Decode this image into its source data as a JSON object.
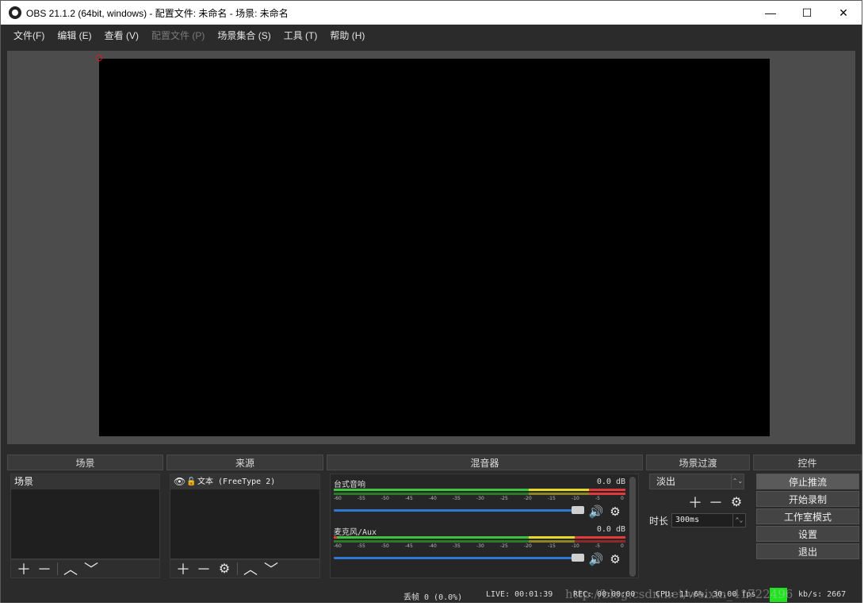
{
  "window": {
    "title": "OBS 21.1.2 (64bit, windows) - 配置文件: 未命名 - 场景: 未命名",
    "minimize": "—",
    "maximize": "☐",
    "close": "✕"
  },
  "menu": [
    {
      "label": "文件(F)",
      "enabled": true
    },
    {
      "label": "编辑 (E)",
      "enabled": true
    },
    {
      "label": "查看 (V)",
      "enabled": true
    },
    {
      "label": "配置文件 (P)",
      "enabled": false
    },
    {
      "label": "场景集合 (S)",
      "enabled": true
    },
    {
      "label": "工具 (T)",
      "enabled": true
    },
    {
      "label": "帮助 (H)",
      "enabled": true
    }
  ],
  "docks": {
    "scenes": {
      "title": "场景",
      "items": [
        "场景"
      ]
    },
    "sources": {
      "title": "来源",
      "items": [
        "文本 (FreeType 2)"
      ]
    },
    "mixer": {
      "title": "混音器",
      "channels": [
        {
          "name": "台式音响",
          "db": "0.0 dB",
          "volume": 0.92
        },
        {
          "name": "麦克风/Aux",
          "db": "0.0 dB",
          "volume": 0.92
        }
      ],
      "ticks": [
        "-60",
        "-55",
        "-50",
        "-45",
        "-40",
        "-35",
        "-30",
        "-25",
        "-20",
        "-15",
        "-10",
        "-5",
        "0"
      ]
    },
    "transitions": {
      "title": "场景过渡",
      "selected": "淡出",
      "duration_label": "时长",
      "duration_value": "300ms"
    },
    "controls": {
      "title": "控件",
      "buttons": [
        "停止推流",
        "开始录制",
        "工作室模式",
        "设置",
        "退出"
      ]
    }
  },
  "status": {
    "dropped": "丢帧 0 (0.0%)",
    "live": "LIVE: 00:01:39",
    "rec": "REC: 00:00:00",
    "cpu": "CPU: 11.6%, 30.00 fps",
    "bitrate": "kb/s: 2667",
    "watermark": "http://blog.csdn.net/weixin_41722496"
  },
  "colors": {
    "accent_blue": "#2f78d6",
    "meter_green": "#3ec43e",
    "meter_yellow": "#e5d92c",
    "meter_red": "#e23a3a",
    "status_green": "#1ee41e"
  }
}
